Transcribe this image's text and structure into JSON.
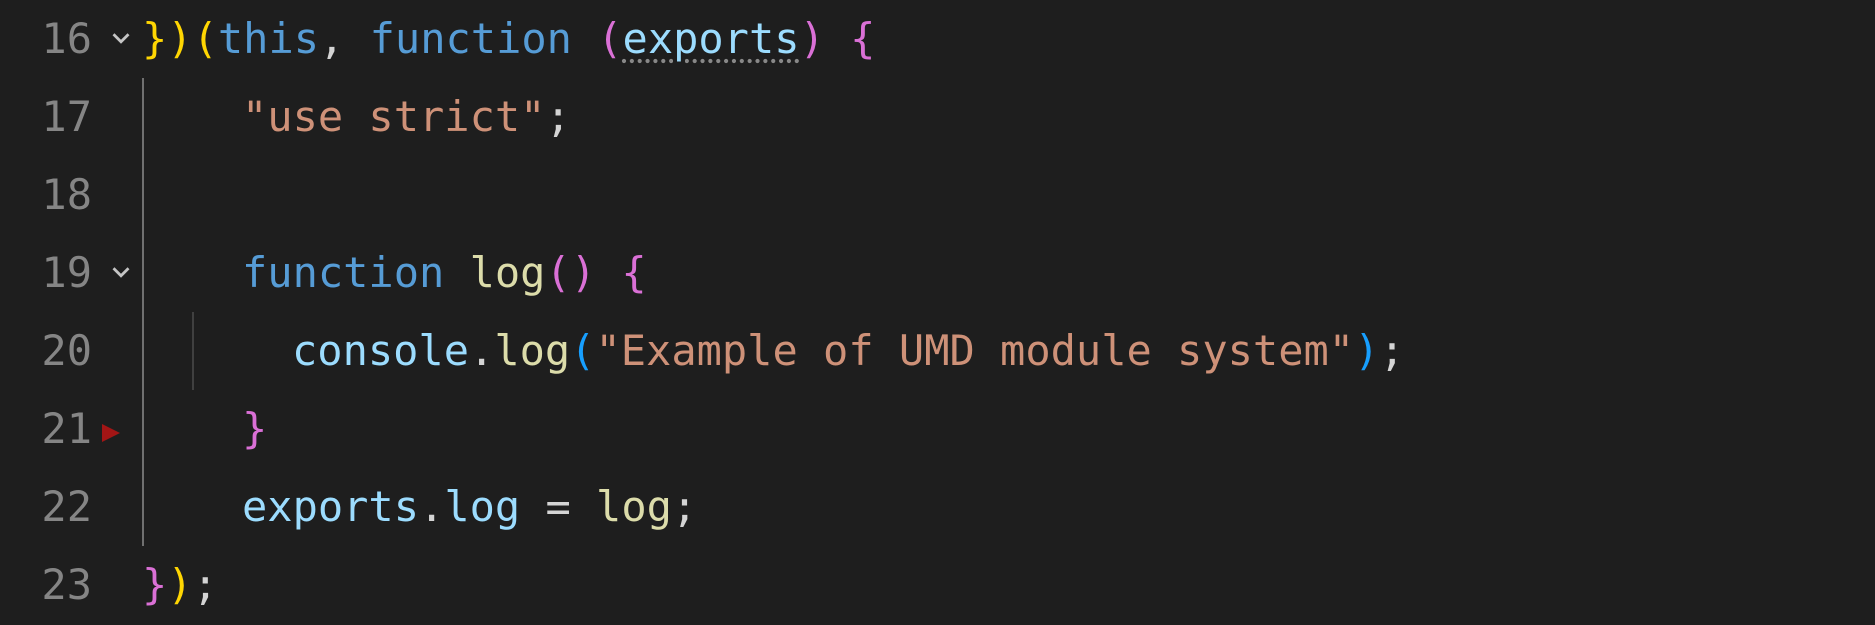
{
  "gutter": {
    "l16": "16",
    "l17": "17",
    "l18": "18",
    "l19": "19",
    "l20": "20",
    "l21": "21",
    "l22": "22",
    "l23": "23"
  },
  "code": {
    "l16": {
      "brace_close1": "}",
      "paren_close1": ")",
      "paren_open2": "(",
      "this_kw": "this",
      "comma": ",",
      "space1": " ",
      "function_kw": "function",
      "space2": " ",
      "paren_open3": "(",
      "param": "exports",
      "paren_close3": ")",
      "space3": " ",
      "brace_open": "{"
    },
    "l17": {
      "string": "\"use strict\"",
      "semi": ";"
    },
    "l19": {
      "function_kw": "function",
      "space1": " ",
      "name": "log",
      "paren_open": "(",
      "paren_close": ")",
      "space2": " ",
      "brace_open": "{"
    },
    "l20": {
      "console": "console",
      "dot1": ".",
      "log": "log",
      "paren_open": "(",
      "string": "\"Example of UMD module system\"",
      "paren_close": ")",
      "semi": ";"
    },
    "l21": {
      "brace_close": "}"
    },
    "l22": {
      "exports": "exports",
      "dot": ".",
      "prop": "log",
      "eq": " = ",
      "rhs": "log",
      "semi": ";"
    },
    "l23": {
      "brace_close": "}",
      "paren_close": ")",
      "semi": ";"
    }
  }
}
